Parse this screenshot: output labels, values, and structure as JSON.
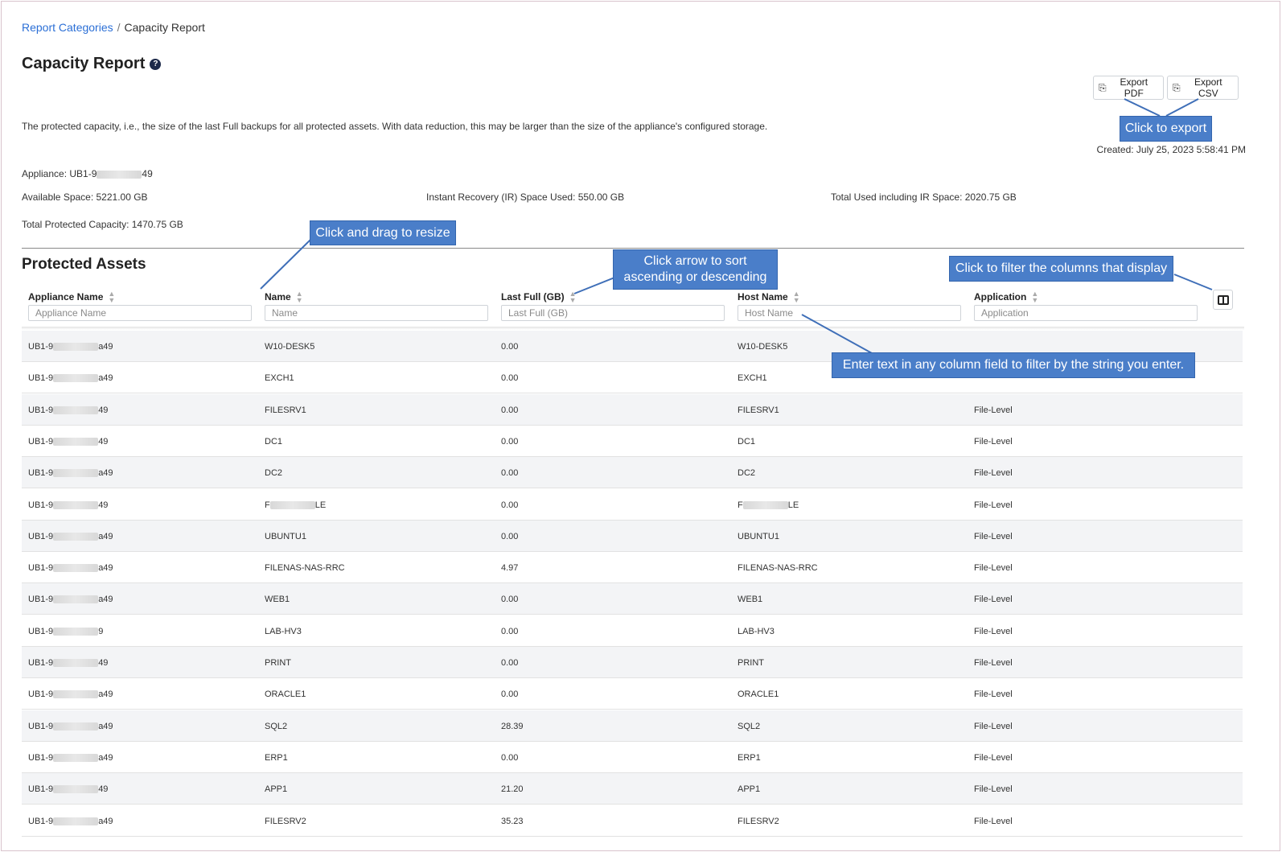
{
  "breadcrumb": {
    "parent": "Report Categories",
    "separator": "/",
    "current": "Capacity Report"
  },
  "page": {
    "title": "Capacity Report",
    "help_glyph": "?",
    "description": "The protected capacity, i.e., the size of the last Full backups for all protected assets. With data reduction, this may be larger than the size of the appliance's configured storage."
  },
  "toolbar": {
    "export_pdf": "Export PDF",
    "export_csv": "Export CSV"
  },
  "created": "Created: July 25, 2023 5:58:41 PM",
  "summary": {
    "appliance_prefix": "Appliance: UB1-9",
    "appliance_suffix": "49",
    "available_space": "Available Space: 5221.00 GB",
    "ir_space_used": "Instant Recovery (IR) Space Used: 550.00 GB",
    "total_used": "Total Used including IR Space: 2020.75 GB",
    "total_protected": "Total Protected Capacity: 1470.75 GB"
  },
  "section_title": "Protected Assets",
  "columns": [
    {
      "label": "Appliance Name",
      "placeholder": "Appliance Name"
    },
    {
      "label": "Name",
      "placeholder": "Name"
    },
    {
      "label": "Last Full (GB)",
      "placeholder": "Last Full (GB)"
    },
    {
      "label": "Host Name",
      "placeholder": "Host Name"
    },
    {
      "label": "Application",
      "placeholder": "Application"
    }
  ],
  "callouts": {
    "export": "Click to export",
    "resize": "Click and drag to resize",
    "sort_line1": "Click arrow to sort",
    "sort_line2": "ascending or descending",
    "filter_columns": "Click to filter the columns that display",
    "filter_text": "Enter text in any column field to filter by the string you enter."
  },
  "rows": [
    {
      "app_prefix": "UB1-9",
      "app_suffix": "a49",
      "name": "W10-DESK5",
      "last_full": "0.00",
      "host": "W10-DESK5",
      "application": ""
    },
    {
      "app_prefix": "UB1-9",
      "app_suffix": "a49",
      "name": "EXCH1",
      "last_full": "0.00",
      "host": "EXCH1",
      "application": ""
    },
    {
      "app_prefix": "UB1-9",
      "app_suffix": "49",
      "name": "FILESRV1",
      "last_full": "0.00",
      "host": "FILESRV1",
      "application": "File-Level"
    },
    {
      "app_prefix": "UB1-9",
      "app_suffix": "49",
      "name": "DC1",
      "last_full": "0.00",
      "host": "DC1",
      "application": "File-Level"
    },
    {
      "app_prefix": "UB1-9",
      "app_suffix": "a49",
      "name": "DC2",
      "last_full": "0.00",
      "host": "DC2",
      "application": "File-Level"
    },
    {
      "app_prefix": "UB1-9",
      "app_suffix": "49",
      "name_prefix": "F",
      "name_suffix": "LE",
      "last_full": "0.00",
      "host_prefix": "F",
      "host_suffix": "LE",
      "application": "File-Level"
    },
    {
      "app_prefix": "UB1-9",
      "app_suffix": "a49",
      "name": "UBUNTU1",
      "last_full": "0.00",
      "host": "UBUNTU1",
      "application": "File-Level"
    },
    {
      "app_prefix": "UB1-9",
      "app_suffix": "a49",
      "name": "FILENAS-NAS-RRC",
      "last_full": "4.97",
      "host": "FILENAS-NAS-RRC",
      "application": "File-Level"
    },
    {
      "app_prefix": "UB1-9",
      "app_suffix": "a49",
      "name": "WEB1",
      "last_full": "0.00",
      "host": "WEB1",
      "application": "File-Level"
    },
    {
      "app_prefix": "UB1-9",
      "app_suffix": "9",
      "name": "LAB-HV3",
      "last_full": "0.00",
      "host": "LAB-HV3",
      "application": "File-Level"
    },
    {
      "app_prefix": "UB1-9",
      "app_suffix": "49",
      "name": "PRINT",
      "last_full": "0.00",
      "host": "PRINT",
      "application": "File-Level"
    },
    {
      "app_prefix": "UB1-9",
      "app_suffix": "a49",
      "name": "ORACLE1",
      "last_full": "0.00",
      "host": "ORACLE1",
      "application": "File-Level"
    },
    {
      "app_prefix": "UB1-9",
      "app_suffix": "a49",
      "name": "SQL2",
      "last_full": "28.39",
      "host": "SQL2",
      "application": "File-Level"
    },
    {
      "app_prefix": "UB1-9",
      "app_suffix": "a49",
      "name": "ERP1",
      "last_full": "0.00",
      "host": "ERP1",
      "application": "File-Level"
    },
    {
      "app_prefix": "UB1-9",
      "app_suffix": "49",
      "name": "APP1",
      "last_full": "21.20",
      "host": "APP1",
      "application": "File-Level"
    },
    {
      "app_prefix": "UB1-9",
      "app_suffix": "a49",
      "name": "FILESRV2",
      "last_full": "35.23",
      "host": "FILESRV2",
      "application": "File-Level"
    }
  ],
  "colors": {
    "link": "#2b6fd6",
    "callout": "#4a7ec9",
    "row_alt": "#f3f4f6"
  }
}
